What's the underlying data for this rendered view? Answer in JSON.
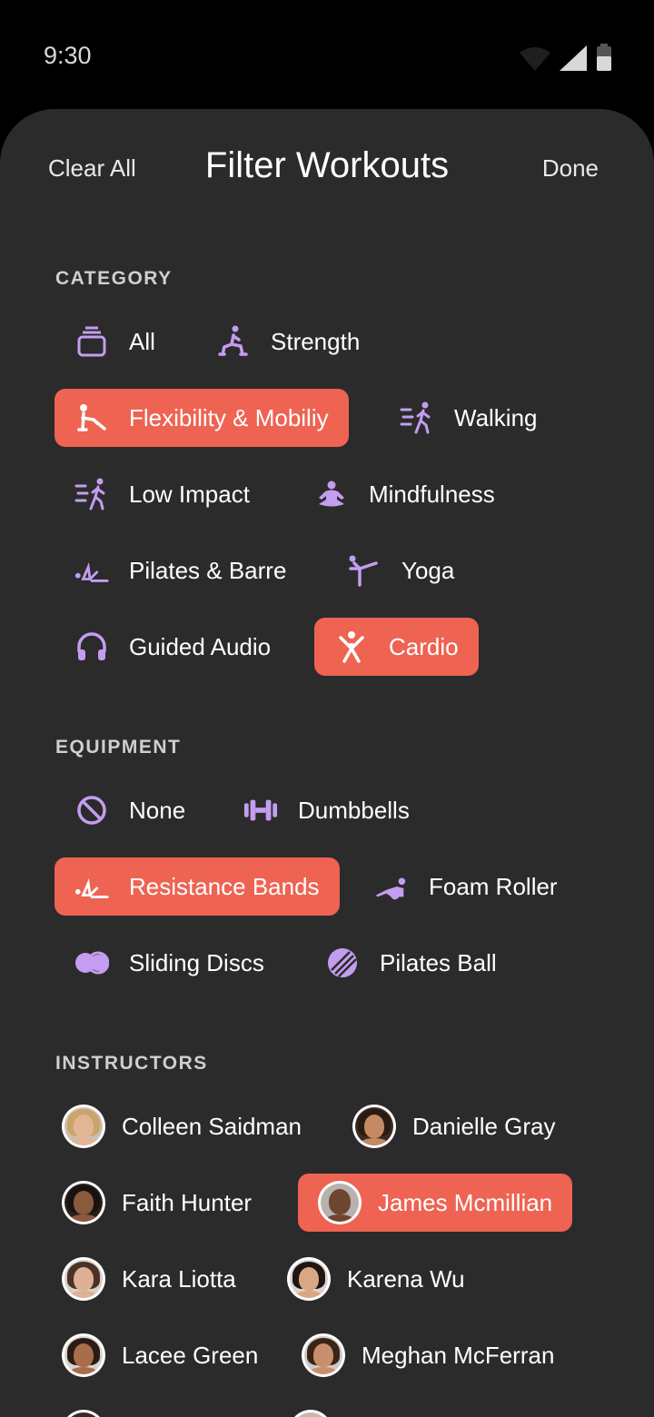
{
  "status": {
    "time": "9:30"
  },
  "header": {
    "clear_all": "Clear All",
    "title": "Filter Workouts",
    "done": "Done"
  },
  "sections": {
    "category": "CATEGORY",
    "equipment": "EQUIPMENT",
    "instructors": "INSTRUCTORS"
  },
  "categories": [
    {
      "label": "All",
      "icon": "stack-icon",
      "selected": false
    },
    {
      "label": "Strength",
      "icon": "lunge-icon",
      "selected": false
    },
    {
      "label": "Flexibility & Mobiliy",
      "icon": "stretch-icon",
      "selected": true
    },
    {
      "label": "Walking",
      "icon": "walking-icon",
      "selected": false
    },
    {
      "label": "Low Impact",
      "icon": "low-impact-icon",
      "selected": false
    },
    {
      "label": "Mindfulness",
      "icon": "meditation-icon",
      "selected": false
    },
    {
      "label": "Pilates & Barre",
      "icon": "pilates-icon",
      "selected": false
    },
    {
      "label": "Yoga",
      "icon": "yoga-icon",
      "selected": false
    },
    {
      "label": "Guided Audio",
      "icon": "headphones-icon",
      "selected": false
    },
    {
      "label": "Cardio",
      "icon": "jumping-jack-icon",
      "selected": true
    }
  ],
  "equipment": [
    {
      "label": "None",
      "icon": "none-icon",
      "selected": false
    },
    {
      "label": "Dumbbells",
      "icon": "dumbbell-icon",
      "selected": false
    },
    {
      "label": "Resistance Bands",
      "icon": "resistance-band-icon",
      "selected": true
    },
    {
      "label": "Foam Roller",
      "icon": "foam-roller-icon",
      "selected": false
    },
    {
      "label": "Sliding Discs",
      "icon": "sliding-discs-icon",
      "selected": false
    },
    {
      "label": "Pilates Ball",
      "icon": "pilates-ball-icon",
      "selected": false
    }
  ],
  "instructors": [
    {
      "name": "Colleen Saidman",
      "selected": false
    },
    {
      "name": "Danielle Gray",
      "selected": false
    },
    {
      "name": "Faith Hunter",
      "selected": false
    },
    {
      "name": "James Mcmillian",
      "selected": true
    },
    {
      "name": "Kara Liotta",
      "selected": false
    },
    {
      "name": "Karena Wu",
      "selected": false
    },
    {
      "name": "Lacee Green",
      "selected": false
    },
    {
      "name": "Meghan McFerran",
      "selected": false
    }
  ],
  "colors": {
    "accent": "#ee6352",
    "icon": "#c49df0",
    "sheet": "#2b2b2b"
  }
}
